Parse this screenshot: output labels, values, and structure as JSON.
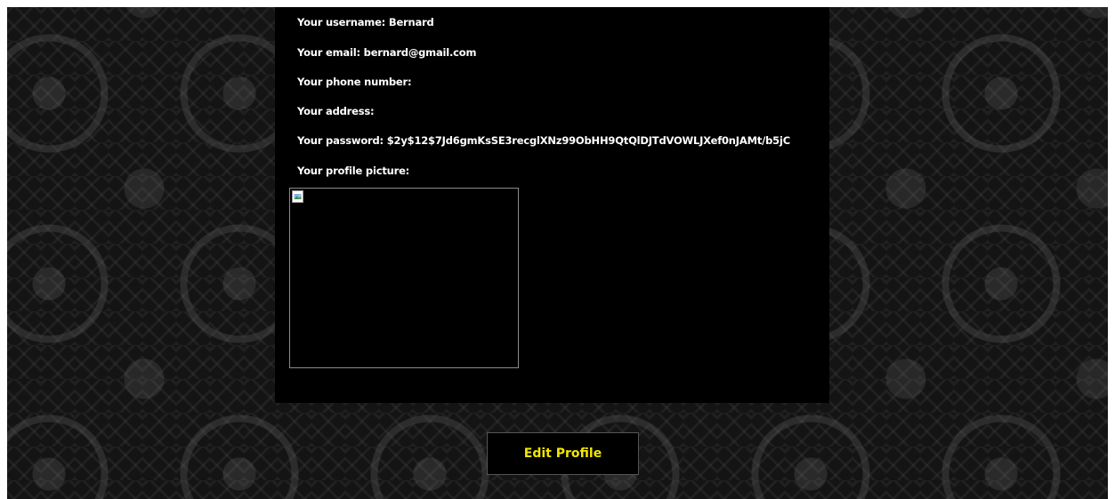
{
  "profile": {
    "username": {
      "label": "Your username: ",
      "value": "Bernard"
    },
    "email": {
      "label": "Your email: ",
      "value": "bernard@gmail.com"
    },
    "phone": {
      "label": "Your phone number:",
      "value": ""
    },
    "address": {
      "label": "Your address:",
      "value": ""
    },
    "password": {
      "label": "Your password: ",
      "value": "$2y$12$7Jd6gmKsSE3recglXNz99ObHH9QtQlDJTdVOWLJXef0nJAMt/b5jC"
    },
    "picture": {
      "label": "Your profile picture:",
      "icon": "broken-image-icon"
    }
  },
  "actions": {
    "edit_profile_label": "Edit Profile"
  },
  "colors": {
    "panel_bg": "#000000",
    "text": "#ffffff",
    "button_text": "#f2e600",
    "image_border": "#8a8a8a"
  }
}
